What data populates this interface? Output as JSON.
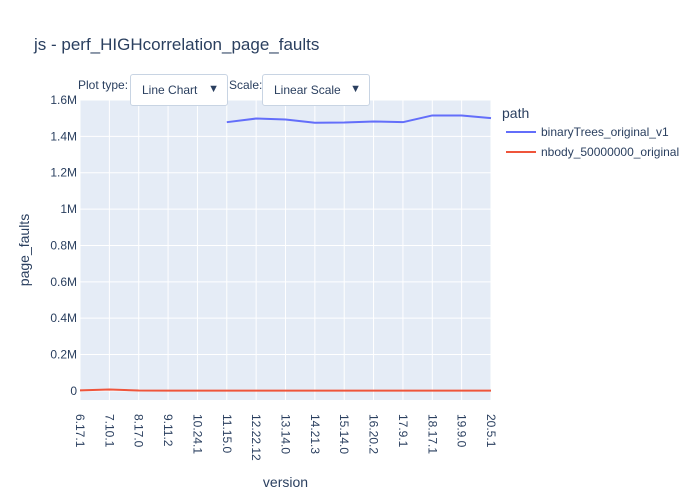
{
  "controls": {
    "plot_type_label": "Plot type:",
    "plot_type_value": "Line Chart",
    "scale_label": "Scale:",
    "scale_value": "Linear Scale",
    "arrow": "▼"
  },
  "chart_data": {
    "type": "line",
    "title": "js - perf_HIGHcorrelation_page_faults",
    "xlabel": "version",
    "ylabel": "page_faults",
    "legend_title": "path",
    "legend_position": "right",
    "grid": true,
    "background": "#e5ecf6",
    "ylim": [
      -50000,
      1600000
    ],
    "yticks": [
      0,
      200000,
      400000,
      600000,
      800000,
      1000000,
      1200000,
      1400000,
      1600000
    ],
    "ytick_labels": [
      "0",
      "0.2M",
      "0.4M",
      "0.6M",
      "0.8M",
      "1M",
      "1.2M",
      "1.4M",
      "1.6M"
    ],
    "categories": [
      "6.17.1",
      "7.10.1",
      "8.17.0",
      "9.11.2",
      "10.24.1",
      "11.15.0",
      "12.22.12",
      "13.14.0",
      "14.21.3",
      "15.14.0",
      "16.20.2",
      "17.9.1",
      "18.17.1",
      "19.9.0",
      "20.5.1"
    ],
    "series": [
      {
        "name": "binaryTrees_original_v1",
        "color": "#636efa",
        "values": [
          null,
          null,
          null,
          null,
          null,
          1478000,
          1498000,
          1493000,
          1475000,
          1476000,
          1482000,
          1478000,
          1515000,
          1515000,
          1500000
        ]
      },
      {
        "name": "nbody_50000000_original",
        "color": "#ef553b",
        "values": [
          3000,
          8000,
          2000,
          1500,
          1500,
          1500,
          1500,
          1500,
          1500,
          1500,
          1500,
          1500,
          1500,
          1500,
          1500
        ]
      }
    ]
  }
}
